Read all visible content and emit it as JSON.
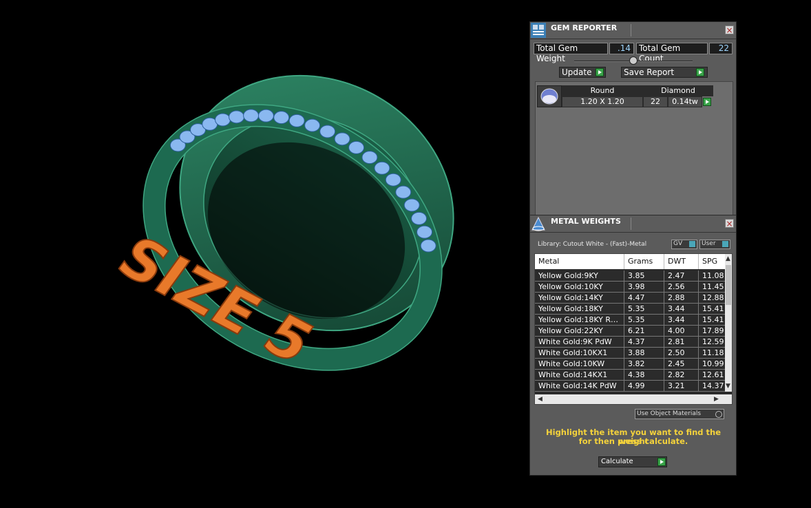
{
  "viewport": {
    "ring_label": "SIZE 5"
  },
  "gem_reporter": {
    "title": "GEM REPORTER",
    "close_icon": "close-icon",
    "total_gem_weight_label": "Total Gem Weight",
    "total_gem_weight_value": ".14",
    "total_gem_count_label": "Total Gem Count",
    "total_gem_count_value": "22",
    "update_label": "Update",
    "save_report_label": "Save Report",
    "gem": {
      "shape": "Round",
      "type": "Diamond",
      "size": "1.20 X 1.20",
      "count": "22",
      "weight": "0.14tw"
    }
  },
  "metal_weights": {
    "title": "METAL WEIGHTS",
    "library": "Library: Cutout White - (Fast)-Metal",
    "gv_label": "GV",
    "user_label": "User",
    "columns": [
      "Metal",
      "Grams",
      "DWT",
      "SPG"
    ],
    "rows": [
      {
        "metal": "Yellow Gold:9KY",
        "grams": "3.85",
        "dwt": "2.47",
        "spg": "11.08"
      },
      {
        "metal": "Yellow Gold:10KY",
        "grams": "3.98",
        "dwt": "2.56",
        "spg": "11.45"
      },
      {
        "metal": "Yellow Gold:14KY",
        "grams": "4.47",
        "dwt": "2.88",
        "spg": "12.88"
      },
      {
        "metal": "Yellow Gold:18KY",
        "grams": "5.35",
        "dwt": "3.44",
        "spg": "15.41"
      },
      {
        "metal": "Yellow Gold:18KY R…",
        "grams": "5.35",
        "dwt": "3.44",
        "spg": "15.41"
      },
      {
        "metal": "Yellow Gold:22KY",
        "grams": "6.21",
        "dwt": "4.00",
        "spg": "17.89"
      },
      {
        "metal": "White Gold:9K PdW",
        "grams": "4.37",
        "dwt": "2.81",
        "spg": "12.59"
      },
      {
        "metal": "White Gold:10KX1",
        "grams": "3.88",
        "dwt": "2.50",
        "spg": "11.18"
      },
      {
        "metal": "White Gold:10KW",
        "grams": "3.82",
        "dwt": "2.45",
        "spg": "10.99"
      },
      {
        "metal": "White Gold:14KX1",
        "grams": "4.38",
        "dwt": "2.82",
        "spg": "12.61"
      },
      {
        "metal": "White Gold:14K PdW",
        "grams": "4.99",
        "dwt": "3.21",
        "spg": "14.37"
      }
    ],
    "use_object_materials_label": "Use Object Materials",
    "hint_line1": "Highlight the item you want to find the weight",
    "hint_line2": "for then press calculate.",
    "calculate_label": "Calculate"
  },
  "colors": {
    "ring": "#1f6b52",
    "gems": "#8ab8f0",
    "label": "#e8792a",
    "hint": "#f4d23b",
    "panel": "#5b5b5b"
  }
}
